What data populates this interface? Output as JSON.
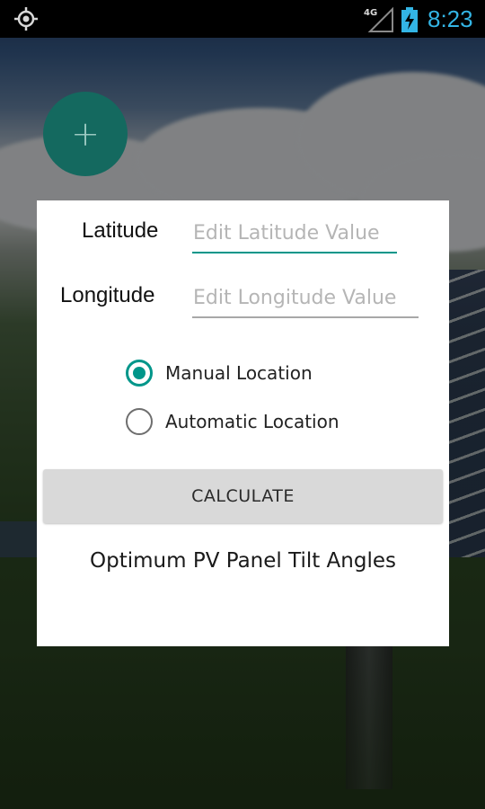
{
  "status_bar": {
    "time": "8:23",
    "network_type": "4G",
    "icons": [
      "gps-icon",
      "signal-icon",
      "battery-charging-icon"
    ],
    "accent_color": "#33b5e5"
  },
  "fab": {
    "icon": "plus-icon",
    "label": "+",
    "color": "#14695f"
  },
  "form": {
    "latitude": {
      "label": "Latitude",
      "value": "",
      "placeholder": "Edit Latitude Value",
      "focused": true
    },
    "longitude": {
      "label": "Longitude",
      "value": "",
      "placeholder": "Edit Longitude Value",
      "focused": false
    },
    "location_mode": {
      "options": [
        {
          "label": "Manual Location",
          "checked": true
        },
        {
          "label": "Automatic Location",
          "checked": false
        }
      ]
    },
    "calculate_label": "CALCULATE",
    "result_text": "Optimum PV Panel Tilt Angles"
  },
  "colors": {
    "accent": "#00968a",
    "button_bg": "#d9d9d9"
  }
}
